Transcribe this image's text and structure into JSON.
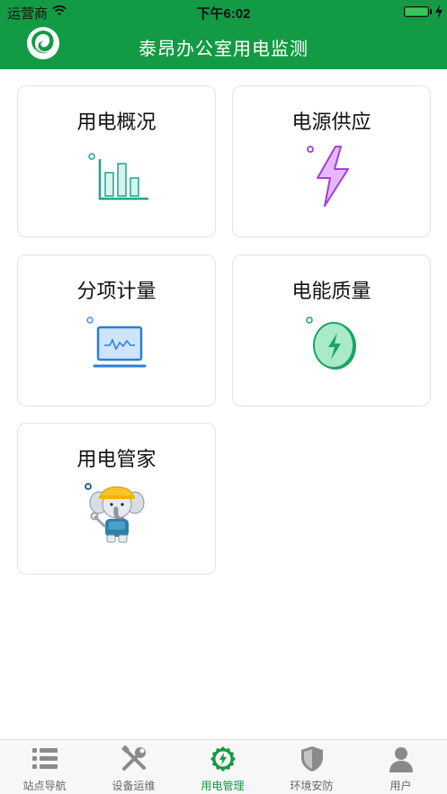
{
  "status_bar": {
    "carrier": "运营商",
    "time": "下午6:02"
  },
  "header": {
    "title": "泰昂办公室用电监测",
    "logo_icon": "leaf-swirl-logo"
  },
  "cards": [
    {
      "label": "用电概况",
      "icon": "bar-chart-icon"
    },
    {
      "label": "电源供应",
      "icon": "lightning-bolt-icon"
    },
    {
      "label": "分项计量",
      "icon": "monitor-waveform-icon"
    },
    {
      "label": "电能质量",
      "icon": "energy-coin-icon"
    },
    {
      "label": "用电管家",
      "icon": "elephant-mascot-icon"
    }
  ],
  "tabbar": {
    "items": [
      {
        "label": "站点导航",
        "icon": "list-icon"
      },
      {
        "label": "设备运维",
        "icon": "tools-icon"
      },
      {
        "label": "用电管理",
        "icon": "gear-bolt-icon",
        "active": true
      },
      {
        "label": "环境安防",
        "icon": "shield-icon"
      },
      {
        "label": "用户",
        "icon": "user-icon"
      }
    ]
  },
  "colors": {
    "brand_green": "#139a44",
    "tab_inactive": "#9a9a9a"
  }
}
